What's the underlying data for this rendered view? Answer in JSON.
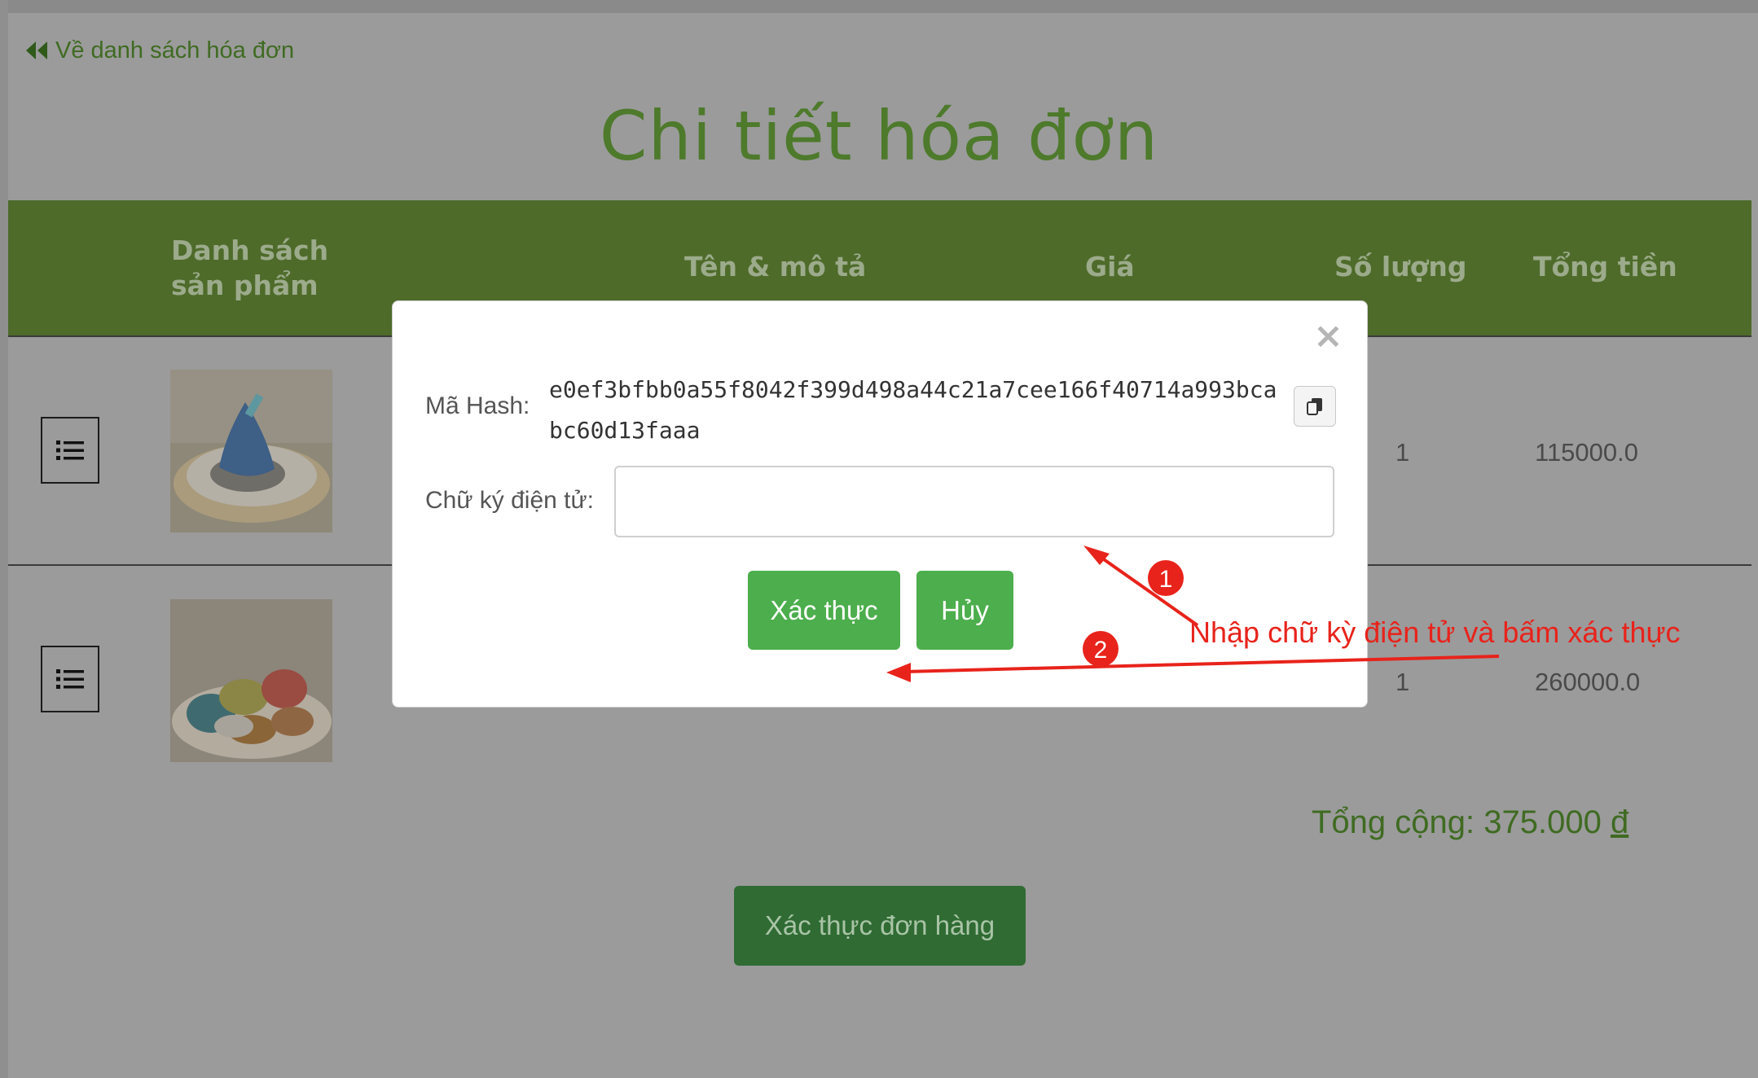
{
  "back_link": {
    "label": "Về danh sách hóa đơn",
    "icon": "double-chevron-left-icon"
  },
  "page_title": "Chi tiết hóa đơn",
  "table": {
    "headers": [
      "Danh sách sản phẩm",
      "Tên & mô tả",
      "Giá",
      "Số lượng",
      "Tổng tiền"
    ],
    "rows": [
      {
        "image": "blue-cake-on-plate",
        "quantity": "1",
        "total": "115000.0"
      },
      {
        "image": "macarons-on-plate",
        "quantity": "1",
        "total": "260000.0"
      }
    ]
  },
  "grand_total": {
    "label": "Tổng cộng: 375.000",
    "currency": "đ"
  },
  "verify_order_label": "Xác thực đơn hàng",
  "modal": {
    "hash_label": "Mã Hash:",
    "hash_value": "e0ef3bfbb0a55f8042f399d498a44c21a7cee166f40714a993bcabc60d13faaa",
    "signature_label": "Chữ ký điện tử:",
    "signature_value": "",
    "confirm_label": "Xác thực",
    "cancel_label": "Hủy",
    "close_glyph": "×"
  },
  "annotation": {
    "text": "Nhập chữ kỳ điện tử và bấm xác thực",
    "steps": [
      "1",
      "2"
    ],
    "color": "#e8231b"
  },
  "colors": {
    "header_bg": "#4e6b2a",
    "title": "#4d7a2b",
    "button_green": "#4cae4c",
    "overlay": "#9b9b9b"
  }
}
